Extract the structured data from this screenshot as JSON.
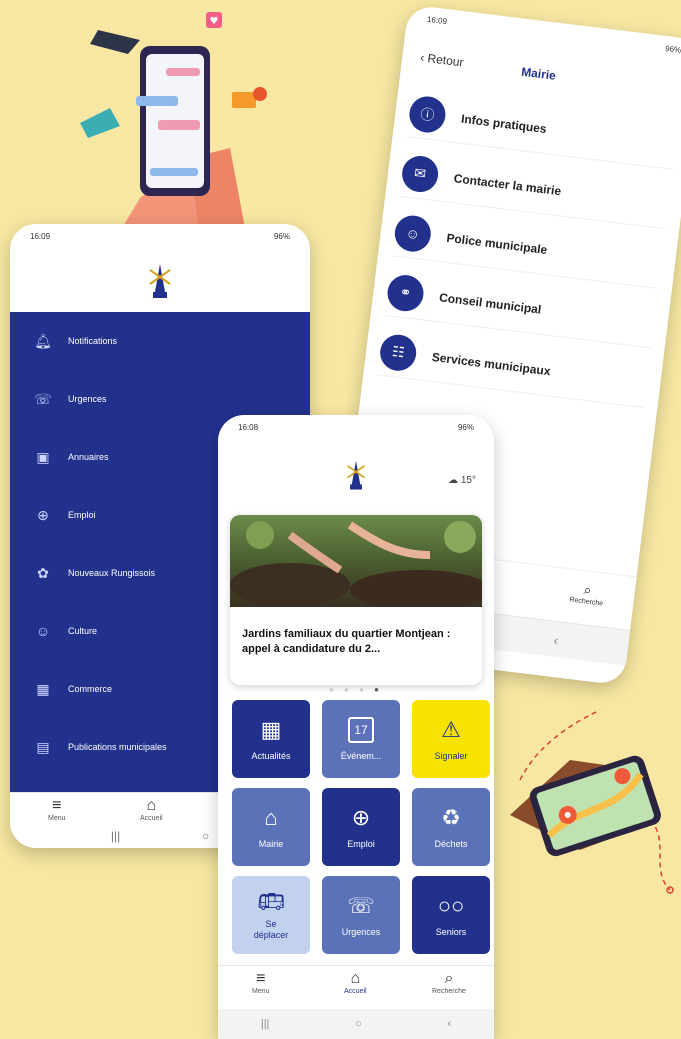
{
  "mairie_screen": {
    "status_time": "16:09",
    "status_right": "96%",
    "back_label": "Retour",
    "title": "Mairie",
    "items": [
      {
        "label": "Infos pratiques",
        "icon": "info-icon"
      },
      {
        "label": "Contacter la mairie",
        "icon": "mail-icon"
      },
      {
        "label": "Police municipale",
        "icon": "police-icon"
      },
      {
        "label": "Conseil municipal",
        "icon": "council-icon"
      },
      {
        "label": "Services municipaux",
        "icon": "services-icon"
      }
    ],
    "tab_search": "Recherche"
  },
  "menu_screen": {
    "status_time": "16:09",
    "status_right": "96%",
    "items": [
      {
        "label": "Notifications",
        "icon": "bell-icon"
      },
      {
        "label": "Urgences",
        "icon": "phone-ring-icon"
      },
      {
        "label": "Annuaires",
        "icon": "address-book-icon"
      },
      {
        "label": "Emploi",
        "icon": "job-search-icon"
      },
      {
        "label": "Nouveaux Rungissois",
        "icon": "welcome-icon"
      },
      {
        "label": "Culture",
        "icon": "theatre-icon"
      },
      {
        "label": "Commerce",
        "icon": "store-icon"
      },
      {
        "label": "Publications municipales",
        "icon": "publication-icon"
      }
    ],
    "tabs": [
      {
        "label": "Menu",
        "icon": "menu-icon"
      },
      {
        "label": "Accueil",
        "icon": "home-icon"
      }
    ]
  },
  "home_screen": {
    "status_time": "16:08",
    "status_right": "96%",
    "weather": "15°",
    "news_title": "Jardins familiaux du quartier Montjean : appel à candidature du 2...",
    "tiles": [
      {
        "label": "Actualités",
        "icon": "news-icon",
        "style": "dark"
      },
      {
        "label": "Événem...",
        "icon": "calendar-icon",
        "style": "mid",
        "icon_text": "17"
      },
      {
        "label": "Signaler",
        "icon": "warning-icon",
        "style": "yellow"
      },
      {
        "label": "Mairie",
        "icon": "town-hall-icon",
        "style": "mid"
      },
      {
        "label": "Emploi",
        "icon": "job-icon",
        "style": "dark"
      },
      {
        "label": "Déchets",
        "icon": "recycle-icon",
        "style": "mid"
      },
      {
        "label": "Se déplacer",
        "icon": "bus-icon",
        "style": "light"
      },
      {
        "label": "Urgences",
        "icon": "phone-ring-icon",
        "style": "mid"
      },
      {
        "label": "Seniors",
        "icon": "glasses-icon",
        "style": "dark"
      }
    ],
    "tabs": [
      {
        "label": "Menu",
        "icon": "menu-icon"
      },
      {
        "label": "Accueil",
        "icon": "home-icon"
      },
      {
        "label": "Recherche",
        "icon": "search-icon"
      }
    ]
  },
  "colors": {
    "background": "#f7e7a2",
    "navy": "#22318c",
    "mid_blue": "#5b72b8",
    "light_blue": "#c2d1ee",
    "yellow": "#f6e300"
  }
}
